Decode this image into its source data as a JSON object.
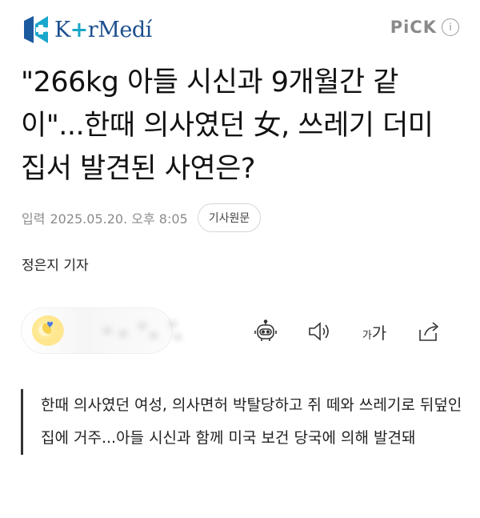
{
  "header": {
    "logo": {
      "prefix": "K",
      "plus": "+",
      "suffix": "r",
      "rest": "Medí"
    },
    "pick_label": "PiCK",
    "pick_info": "i"
  },
  "article": {
    "title": "\"266kg 아들 시신과 9개월간 같이\"...한때 의사였던 女, 쓰레기 더미 집서 발견된 사연은?",
    "meta": {
      "label": "입력",
      "date": "2025.05.20. 오후 8:05",
      "origin_button": "기사원문"
    },
    "reporter": "정은지 기자",
    "font_size_label_small": "가",
    "font_size_label_large": "가",
    "summary": "한때 의사였던 여성, 의사면허 박탈당하고 쥐 떼와 쓰레기로 뒤덮인 집에 거주...아들 시신과 함께 미국 보건 당국에 의해 발견돼"
  },
  "icons": {
    "logo_mark": "kormedi-logo-icon",
    "robot": "ai-summary-robot-icon",
    "sound": "speaker-icon",
    "share": "share-icon"
  },
  "colors": {
    "brand_blue": "#1c4f8f",
    "brand_cyan": "#19a6c9",
    "muted": "#8b8b8b"
  }
}
